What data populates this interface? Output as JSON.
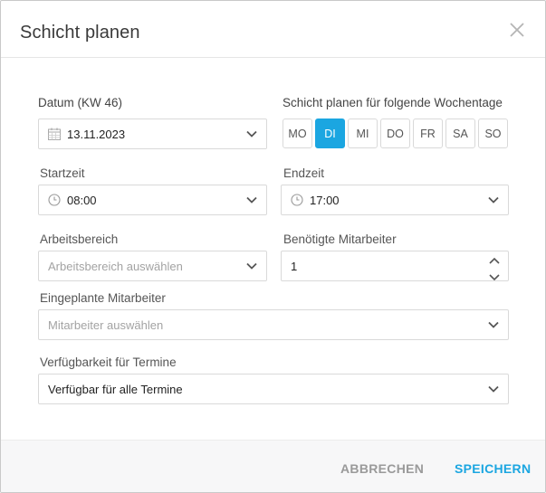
{
  "dialog": {
    "title": "Schicht planen"
  },
  "form": {
    "date": {
      "label": "Datum (KW 46)",
      "value": "13.11.2023"
    },
    "weekdays": {
      "label": "Schicht planen für folgende Wochentage",
      "days": [
        "MO",
        "DI",
        "MI",
        "DO",
        "FR",
        "SA",
        "SO"
      ],
      "selected": "DI"
    },
    "start_time": {
      "label": "Startzeit",
      "value": "08:00"
    },
    "end_time": {
      "label": "Endzeit",
      "value": "17:00"
    },
    "work_area": {
      "label": "Arbeitsbereich",
      "placeholder": "Arbeitsbereich auswählen"
    },
    "required_staff": {
      "label": "Benötigte Mitarbeiter",
      "value": "1"
    },
    "planned_staff": {
      "label": "Eingeplante Mitarbeiter",
      "placeholder": "Mitarbeiter auswählen"
    },
    "availability": {
      "label": "Verfügbarkeit für Termine",
      "value": "Verfügbar für alle Termine"
    }
  },
  "footer": {
    "cancel_label": "ABBRECHEN",
    "save_label": "SPEICHERN"
  },
  "colors": {
    "accent": "#1ba6e1",
    "muted_button": "#9a9a9a"
  },
  "icons": [
    "close-icon",
    "calendar-icon",
    "clock-icon",
    "chevron-down-icon",
    "chevron-up-icon"
  ]
}
